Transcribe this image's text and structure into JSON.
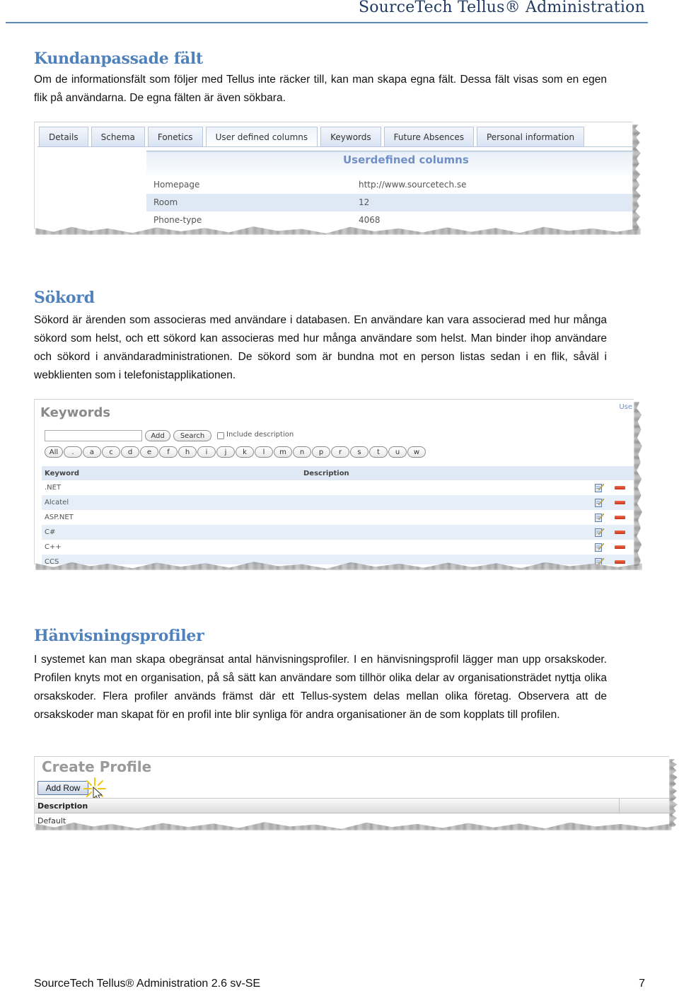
{
  "header": {
    "title": "SourceTech Tellus® Administration"
  },
  "sections": [
    {
      "heading": "Kundanpassade fält",
      "body": "Om de informationsfält som följer med Tellus inte räcker till, kan man skapa egna fält. Dessa fält visas som en egen flik på användarna. De egna fälten är även sökbara."
    },
    {
      "heading": "Sökord",
      "body": "Sökord är ärenden som associeras med användare i databasen. En användare kan vara associerad med hur många sökord som helst, och ett sökord kan associeras med hur många användare som helst. Man binder ihop användare och sökord i användaradministrationen. De sökord som är bundna mot en person listas sedan i en flik, såväl i webklienten som i telefonistapplikationen."
    },
    {
      "heading": "Hänvisningsprofiler",
      "body": "I systemet kan man skapa obegränsat antal hänvisningsprofiler. I en hänvisningsprofil lägger man upp orsakskoder. Profilen knyts mot en organisation, på så sätt kan användare som tillhör olika delar av organisationsträdet nyttja olika orsakskoder. Flera profiler används främst där ett Tellus-system delas mellan olika företag. Observera att de orsakskoder man skapat för en profil inte blir synliga för andra organisationer än de som kopplats till profilen."
    }
  ],
  "userdefined_screenshot": {
    "tabs": [
      {
        "label": "Details",
        "active": false
      },
      {
        "label": "Schema",
        "active": false
      },
      {
        "label": "Fonetics",
        "active": false
      },
      {
        "label": "User defined columns",
        "active": true
      },
      {
        "label": "Keywords",
        "active": false
      },
      {
        "label": "Future Absences",
        "active": false
      },
      {
        "label": "Personal information",
        "active": false
      }
    ],
    "panel_title": "Userdefined columns",
    "rows": [
      {
        "field": "Homepage",
        "value": "http://www.sourcetech.se"
      },
      {
        "field": "Room",
        "value": "12"
      },
      {
        "field": "Phone-type",
        "value": "4068"
      }
    ]
  },
  "keywords_screenshot": {
    "title": "Keywords",
    "user_link": "Use",
    "search_input_value": "",
    "add_label": "Add",
    "search_label": "Search",
    "include_description_label": "Include description",
    "include_description_checked": false,
    "letters": [
      "All",
      ".",
      "a",
      "c",
      "d",
      "e",
      "f",
      "h",
      "i",
      "j",
      "k",
      "l",
      "m",
      "n",
      "p",
      "r",
      "s",
      "t",
      "u",
      "w"
    ],
    "columns": [
      "Keyword",
      "Description"
    ],
    "rows": [
      {
        "keyword": ".NET",
        "description": ""
      },
      {
        "keyword": "Alcatel",
        "description": ""
      },
      {
        "keyword": "ASP.NET",
        "description": ""
      },
      {
        "keyword": "C#",
        "description": ""
      },
      {
        "keyword": "C++",
        "description": ""
      },
      {
        "keyword": "CCS",
        "description": ""
      }
    ],
    "row_actions": {
      "edit": "edit-icon",
      "delete": "delete-icon"
    }
  },
  "createprofile_screenshot": {
    "title": "Create Profile",
    "add_row_label": "Add Row",
    "column_header": "Description",
    "first_row": "Default"
  },
  "footer": {
    "left": "SourceTech Tellus® Administration 2.6 sv-SE",
    "page_number": "7"
  },
  "colors": {
    "heading": "#4f81bd",
    "header_title": "#1f3a5f",
    "header_rule": "#5b8bc0",
    "panel_title": "#6f8fc6",
    "row_alt": "#dfe9f6",
    "delete": "#d8462a"
  }
}
